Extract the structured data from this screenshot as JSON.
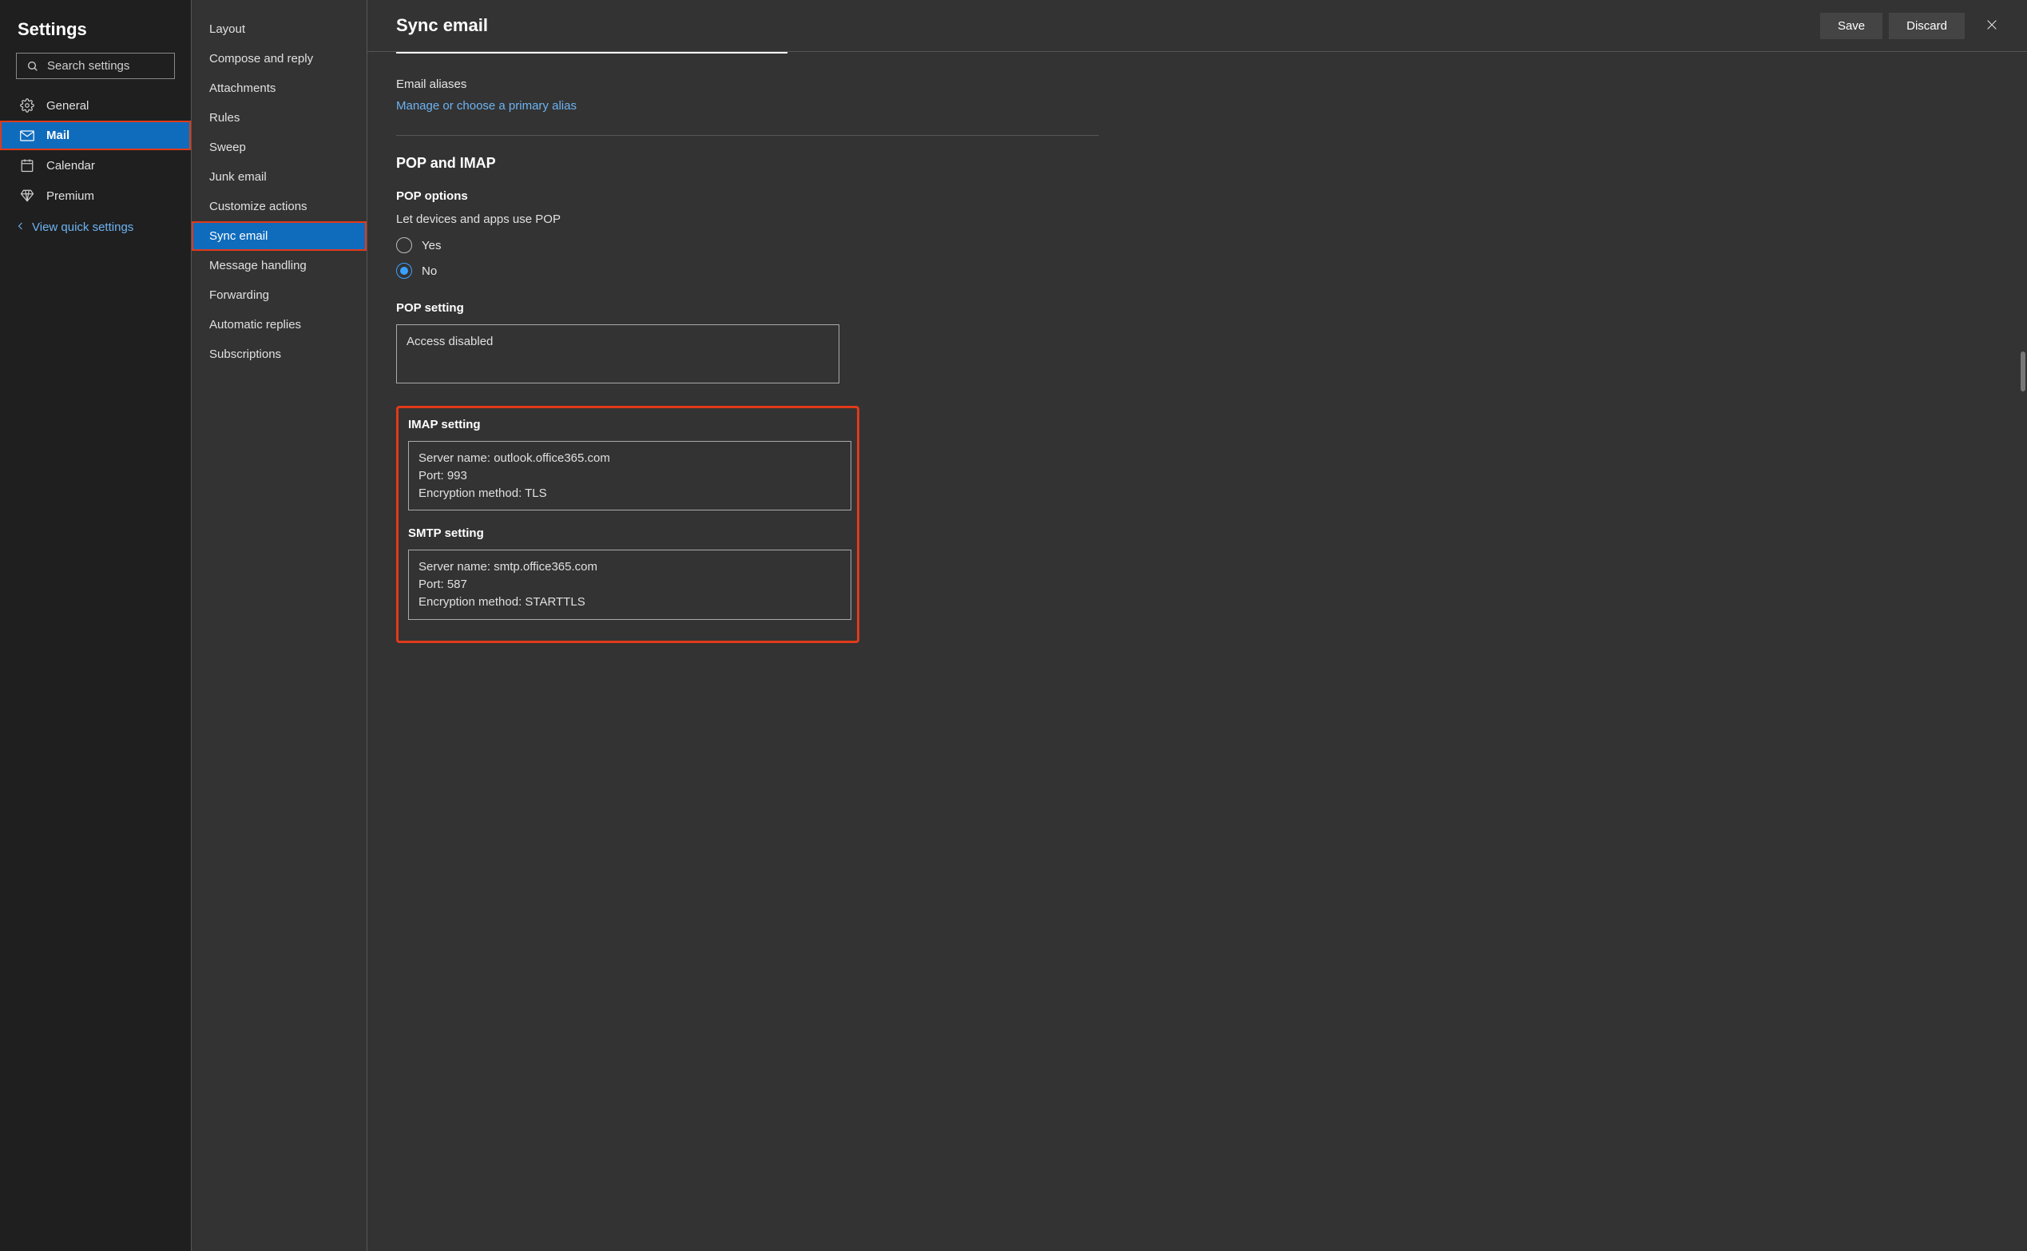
{
  "sidebarLeft": {
    "title": "Settings",
    "searchPlaceholder": "Search settings",
    "items": [
      {
        "label": "General",
        "icon": "gear"
      },
      {
        "label": "Mail",
        "icon": "mail"
      },
      {
        "label": "Calendar",
        "icon": "calendar"
      },
      {
        "label": "Premium",
        "icon": "diamond"
      }
    ],
    "quickLink": "View quick settings"
  },
  "sidebarMid": {
    "items": [
      "Layout",
      "Compose and reply",
      "Attachments",
      "Rules",
      "Sweep",
      "Junk email",
      "Customize actions",
      "Sync email",
      "Message handling",
      "Forwarding",
      "Automatic replies",
      "Subscriptions"
    ]
  },
  "header": {
    "title": "Sync email",
    "save": "Save",
    "discard": "Discard"
  },
  "aliases": {
    "label": "Email aliases",
    "link": "Manage or choose a primary alias"
  },
  "popImap": {
    "heading": "POP and IMAP",
    "popOptions": {
      "heading": "POP options",
      "desc": "Let devices and apps use POP",
      "yes": "Yes",
      "no": "No"
    },
    "popSetting": {
      "heading": "POP setting",
      "body": "Access disabled"
    },
    "imapSetting": {
      "heading": "IMAP setting",
      "line1": "Server name: outlook.office365.com",
      "line2": "Port: 993",
      "line3": "Encryption method: TLS"
    },
    "smtpSetting": {
      "heading": "SMTP setting",
      "line1": "Server name: smtp.office365.com",
      "line2": "Port: 587",
      "line3": "Encryption method: STARTTLS"
    }
  }
}
